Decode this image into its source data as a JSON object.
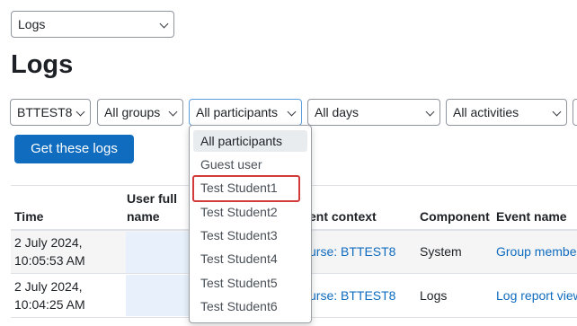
{
  "top_select": {
    "value": "Logs"
  },
  "page_title": "Logs",
  "filters": {
    "course": "BTTEST8",
    "groups": "All groups",
    "participants": "All participants",
    "days": "All days",
    "activities": "All activities"
  },
  "get_logs_label": "Get these logs",
  "participants_dropdown": {
    "options": [
      "All participants",
      "Guest user",
      "Test Student1",
      "Test Student2",
      "Test Student3",
      "Test Student4",
      "Test Student5",
      "Test Student6"
    ],
    "selected_index": 0,
    "highlighted_option": "Test Student1",
    "highlight_color": "#d33a3a"
  },
  "table": {
    "headers": {
      "time": "Time",
      "user_full_name_line1": "User full",
      "user_full_name_line2": "name",
      "event_context": "ent context",
      "component": "Component",
      "event_name": "Event name"
    },
    "rows": [
      {
        "time_line1": "2 July 2024,",
        "time_line2": "10:05:53 AM",
        "event_context": "urse: BTTEST8",
        "component": "System",
        "event_name": "Group member"
      },
      {
        "time_line1": "2 July 2024,",
        "time_line2": "10:04:25 AM",
        "event_context": "urse: BTTEST8",
        "component": "Logs",
        "event_name": "Log report view"
      }
    ]
  },
  "colors": {
    "primary": "#0f6cbf",
    "link": "#0f6cbf",
    "text": "#1d2125"
  }
}
